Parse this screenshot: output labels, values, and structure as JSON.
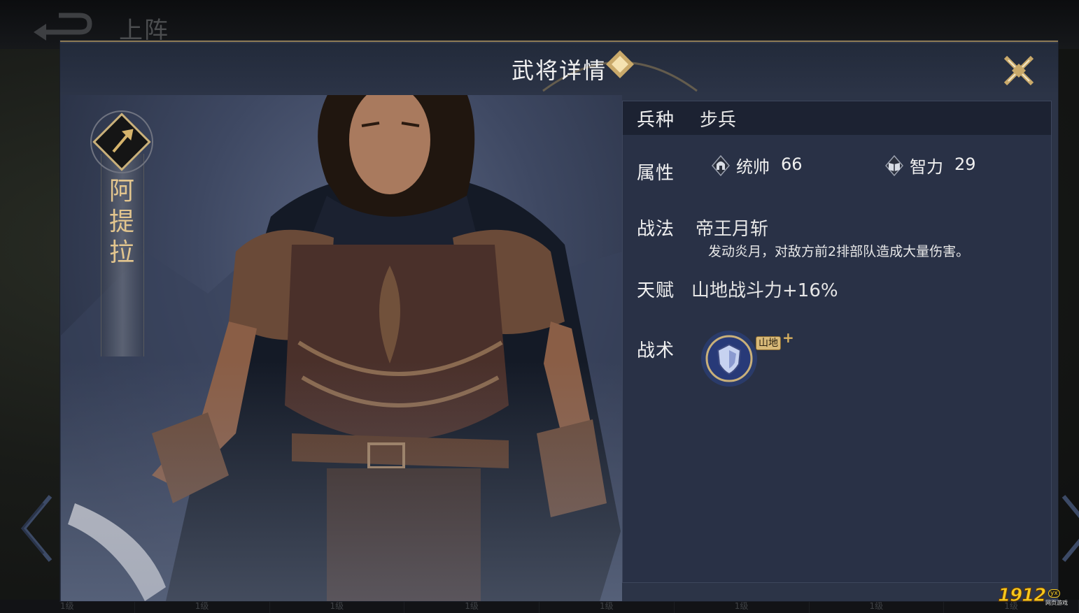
{
  "background": {
    "topbar_title": "上阵",
    "level_cells": [
      "1级",
      "1级",
      "1级",
      "1级",
      "1级",
      "1级",
      "1级",
      "1级"
    ]
  },
  "dialog": {
    "title": "武将详情"
  },
  "hero": {
    "name": "阿提拉",
    "class_icon": "spear-icon"
  },
  "info": {
    "troop": {
      "label": "兵种",
      "value": "步兵"
    },
    "attributes": {
      "label": "属性",
      "command": {
        "name": "统帅",
        "value": "66",
        "icon": "helmet-icon"
      },
      "intellect": {
        "name": "智力",
        "value": "29",
        "icon": "book-icon"
      }
    },
    "skill": {
      "label": "战法",
      "name": "帝王月斩",
      "description": "发动炎月，对敌方前2排部队造成大量伤害。"
    },
    "talent": {
      "label": "天赋",
      "value": "山地战斗力+16%"
    },
    "tactic": {
      "label": "战术",
      "icon": "shield-icon",
      "tag": "山地",
      "plus": "+"
    }
  },
  "watermark": {
    "text": "1912",
    "badge": "yx",
    "sub": "网页游戏"
  },
  "colors": {
    "dialog_bg": "#2c3447",
    "panel_bg": "#293146",
    "name_gold": "#e2c58e",
    "accent_gold": "#c8a765"
  }
}
